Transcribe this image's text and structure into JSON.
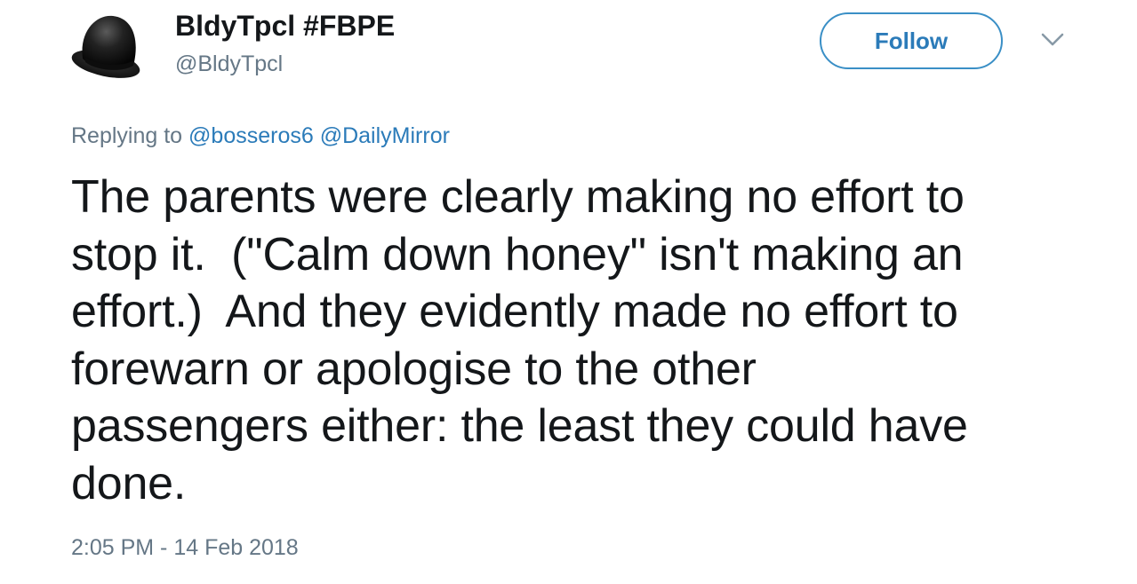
{
  "author": {
    "display_name": "BldyTpcl #FBPE",
    "handle": "@BldyTpcl",
    "avatar_icon": "bowler-hat-icon"
  },
  "actions": {
    "follow_label": "Follow",
    "menu_icon": "chevron-down-icon"
  },
  "reply": {
    "prefix": "Replying to",
    "mentions": [
      "@bosseros6",
      "@DailyMirror"
    ]
  },
  "tweet": {
    "lines": [
      "The parents were clearly making no effort to",
      "stop it.  (\"Calm down honey\" isn't making an",
      "effort.)  And they evidently made no effort to",
      "forewarn or apologise to the other",
      "passengers either: the least they could have",
      "done."
    ]
  },
  "meta": {
    "timestamp": "2:05 PM - 14 Feb 2018"
  },
  "colors": {
    "text": "#14171a",
    "secondary": "#657786",
    "link": "#2b7bb9",
    "follow_border": "#3a8fc6"
  }
}
